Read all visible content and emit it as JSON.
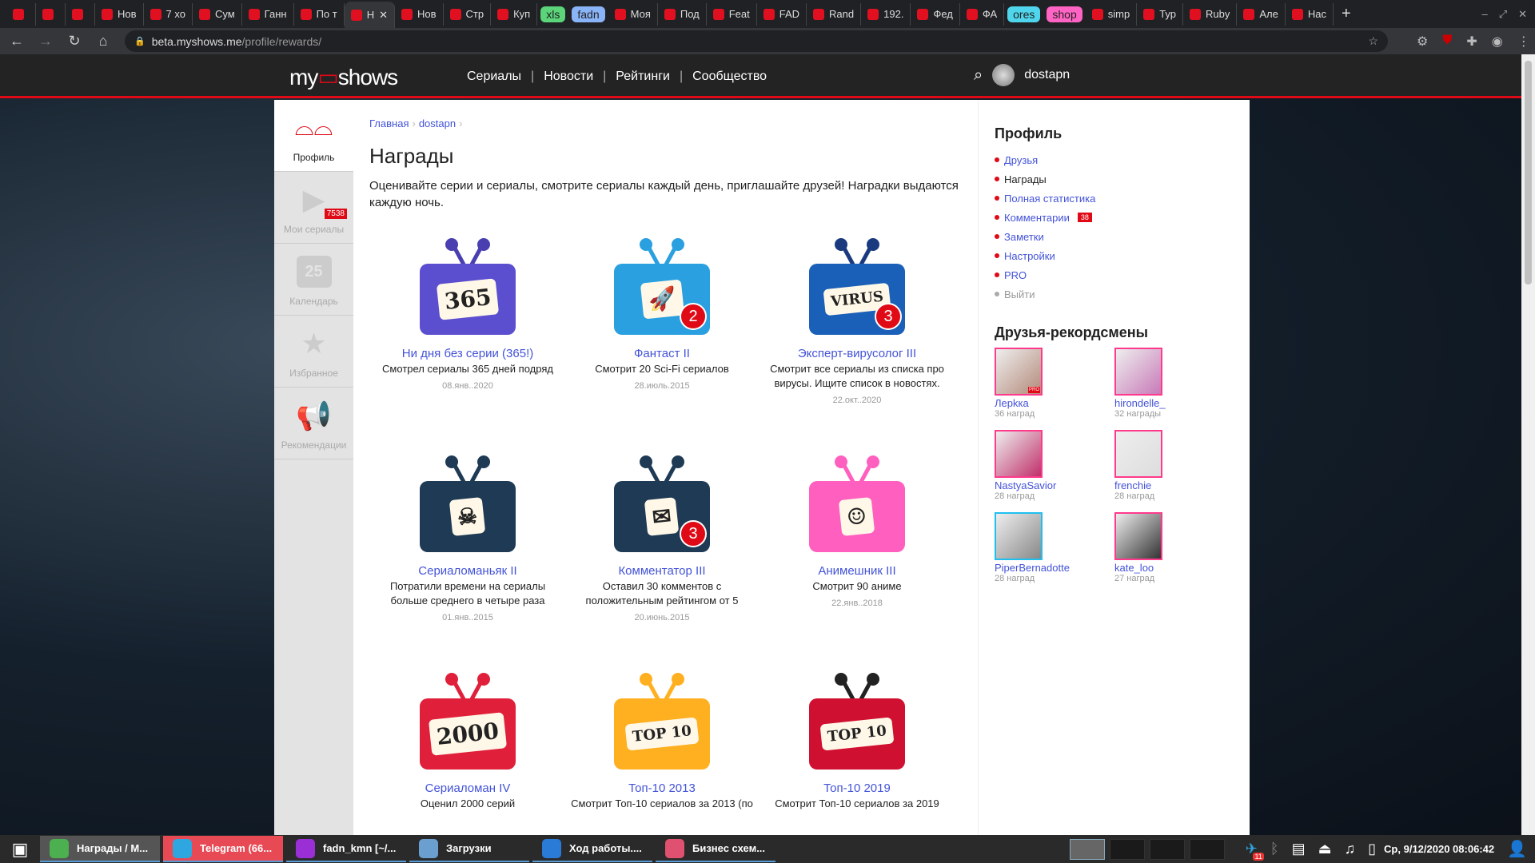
{
  "browser": {
    "tabs": [
      "",
      "",
      "",
      "Нов",
      "7 хо",
      "Сум",
      "Ганн",
      "По т",
      "Н",
      "Нов",
      "Стр",
      "Куп",
      "xls",
      "fadn",
      "Моя",
      "Под",
      "Feat",
      "FAD",
      "Rand",
      "192.",
      "Фед",
      "ФА",
      "ores",
      "shop",
      "simp",
      "Тур",
      "Ruby",
      "Але",
      "Нас"
    ],
    "group_colors": {
      "xls": "#5bd47a",
      "fadn": "#8ab4f8",
      "ores": "#4fd6ec",
      "shop": "#ff63c3"
    },
    "url_host": "beta.myshows.me",
    "url_path": "/profile/rewards/"
  },
  "site": {
    "logo": {
      "pre": "my",
      "mid": "▭",
      "post": "shows"
    },
    "nav": [
      "Сериалы",
      "Новости",
      "Рейтинги",
      "Сообщество"
    ],
    "username": "dostapn",
    "accent": "#e00a16",
    "link": "#4353d8"
  },
  "leftnav": [
    {
      "label": "Профиль",
      "icon": "glasses-icon"
    },
    {
      "label": "Мои сериалы",
      "icon": "play-icon",
      "badge": "7538"
    },
    {
      "label": "Календарь",
      "icon": "calendar-tv-icon",
      "num": "25"
    },
    {
      "label": "Избранное",
      "icon": "star-icon"
    },
    {
      "label": "Рекомендации",
      "icon": "megaphone-icon"
    }
  ],
  "main": {
    "breadcrumbs": [
      "Главная",
      "dostapn"
    ],
    "title": "Награды",
    "intro": "Оценивайте серии и сериалы, смотрите сериалы каждый день, приглашайте друзей! Наградки выдаются каждую ночь.",
    "awards": [
      {
        "title": "Ни дня без серии (365!)",
        "desc": "Смотрел сериалы 365 дней подряд",
        "date": "08.янв..2020",
        "art": "365",
        "color": "#5b4fd0",
        "ant": "#4a3fb0"
      },
      {
        "title": "Фантаст II",
        "desc": "Смотрит 20 Sci-Fi сериалов",
        "date": "28.июль.2015",
        "art": "🚀",
        "level": "2",
        "color": "#2aa0e0",
        "ant": "#2aa0e0"
      },
      {
        "title": "Эксперт-вирусолог III",
        "desc": "Смотрит все сериалы из списка про вирусы. Ищите список в новостях.",
        "date": "22.окт..2020",
        "art": "VIRUS",
        "level": "3",
        "color": "#1a5fb8",
        "ant": "#1a3a80"
      },
      {
        "title": "Сериаломаньяк II",
        "desc": "Потратили времени на сериалы больше среднего в четыре раза",
        "date": "01.янв..2015",
        "art": "☠",
        "color": "#1e3a55",
        "ant": "#1e3a55"
      },
      {
        "title": "Комментатор III",
        "desc": "Оставил 30 комментов с положительным рейтингом от 5",
        "date": "20.июнь.2015",
        "art": "✉",
        "level": "3",
        "color": "#1e3a55",
        "ant": "#1e3a55"
      },
      {
        "title": "Анимешник III",
        "desc": "Смотрит 90 аниме",
        "date": "22.янв..2018",
        "art": "☺",
        "color": "#ff5fbf",
        "ant": "#ff5fbf"
      },
      {
        "title": "Сериаломан IV",
        "desc": "Оценил 2000 серий",
        "date": "",
        "art": "2000",
        "color": "#e0203a",
        "ant": "#e0203a"
      },
      {
        "title": "Топ-10 2013",
        "desc": "Смотрит Топ-10 сериалов за 2013 (по",
        "date": "",
        "art": "TOP 10",
        "color": "#ffb020",
        "ant": "#ffb020"
      },
      {
        "title": "Топ-10 2019",
        "desc": "Смотрит Топ-10 сериалов за 2019",
        "date": "",
        "art": "TOP 10",
        "color": "#d01030",
        "ant": "#222"
      }
    ]
  },
  "sidebar": {
    "profile_title": "Профиль",
    "links": [
      {
        "label": "Друзья"
      },
      {
        "label": "Награды",
        "current": true
      },
      {
        "label": "Полная статистика"
      },
      {
        "label": "Комментарии",
        "badge": "38"
      },
      {
        "label": "Заметки"
      },
      {
        "label": "Настройки"
      },
      {
        "label": "PRO"
      },
      {
        "label": "Выйти",
        "muted": true
      }
    ],
    "friends_title": "Друзья-рекордсмены",
    "friends": [
      {
        "name": "Лерkка",
        "count": "36 наград",
        "pro": "PRO",
        "color": "#b48a7a"
      },
      {
        "name": "hirondelle_",
        "count": "32 награды",
        "color": "#c87ab8"
      },
      {
        "name": "NastyaSavior",
        "count": "28 наград",
        "color": "#c0306a"
      },
      {
        "name": "frenchie",
        "count": "28 наград",
        "color": "#ddd"
      },
      {
        "name": "PiperBernadotte",
        "count": "28 наград",
        "color": "#888"
      },
      {
        "name": "kate_loo",
        "count": "27 наград",
        "color": "#333"
      }
    ]
  },
  "taskbar": {
    "apps": [
      {
        "label": "Награды / М...",
        "color": "#4caf50"
      },
      {
        "label": "Telegram (66...",
        "color": "#2ea6e0"
      },
      {
        "label": "fadn_kmn [~/...",
        "color": "#9b2fd6"
      },
      {
        "label": "Загрузки",
        "color": "#6a9fd0"
      },
      {
        "label": "Ход работы....",
        "color": "#2a7bd8"
      },
      {
        "label": "Бизнес схем...",
        "color": "#e05070"
      }
    ],
    "telegram_badge": "11",
    "clock": "Ср, 9/12/2020 08:06:42"
  }
}
